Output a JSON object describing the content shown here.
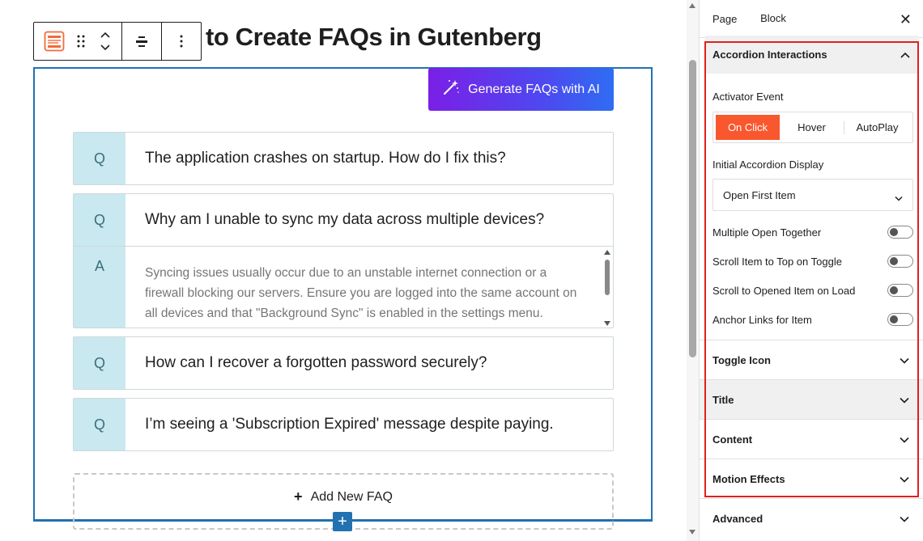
{
  "editor": {
    "page_title": "to Create FAQs in Gutenberg",
    "generate_button": "Generate FAQs with AI",
    "faq_items": [
      {
        "mark": "Q",
        "question": "The application crashes on startup. How do I fix this?"
      },
      {
        "mark": "Q",
        "question": "Why am I unable to sync my data across multiple devices?",
        "answer_mark": "A",
        "answer": "Syncing issues usually occur due to an unstable internet connection or a firewall blocking our servers. Ensure you are logged into the same account on all devices and that \"Background Sync\" is enabled in the settings menu."
      },
      {
        "mark": "Q",
        "question": "How can I recover a forgotten password securely?"
      },
      {
        "mark": "Q",
        "question": "I’m seeing a 'Subscription Expired' message despite paying."
      }
    ],
    "add_new_faq": "Add New FAQ",
    "add_new_faq_icon": "+",
    "inserter_icon": "+"
  },
  "sidebar": {
    "tabs": [
      "Page",
      "Block"
    ],
    "active_tab": "Block",
    "close_icon": "✕",
    "accordion_interactions": {
      "title": "Accordion Interactions",
      "activator_label": "Activator Event",
      "activator_options": [
        "On Click",
        "Hover",
        "AutoPlay"
      ],
      "activator_selected": "On Click",
      "initial_display_label": "Initial Accordion Display",
      "initial_display_value": "Open First Item",
      "toggles": [
        {
          "label": "Multiple Open Together",
          "on": false
        },
        {
          "label": "Scroll Item to Top on Toggle",
          "on": false
        },
        {
          "label": "Scroll to Opened Item on Load",
          "on": false
        },
        {
          "label": "Anchor Links for Item",
          "on": false
        }
      ]
    },
    "panels": [
      "Toggle Icon",
      "Title",
      "Content",
      "Motion Effects",
      "Advanced"
    ]
  },
  "colors": {
    "accent_blue": "#2271b1",
    "active_orange": "#f9572e",
    "highlight_red": "#e0201e",
    "faq_mark_bg": "#c9e8ef",
    "gen_gradient_start": "#7b1fe6",
    "gen_gradient_end": "#2f6df2",
    "block_icon_orange": "#f26b3a"
  }
}
